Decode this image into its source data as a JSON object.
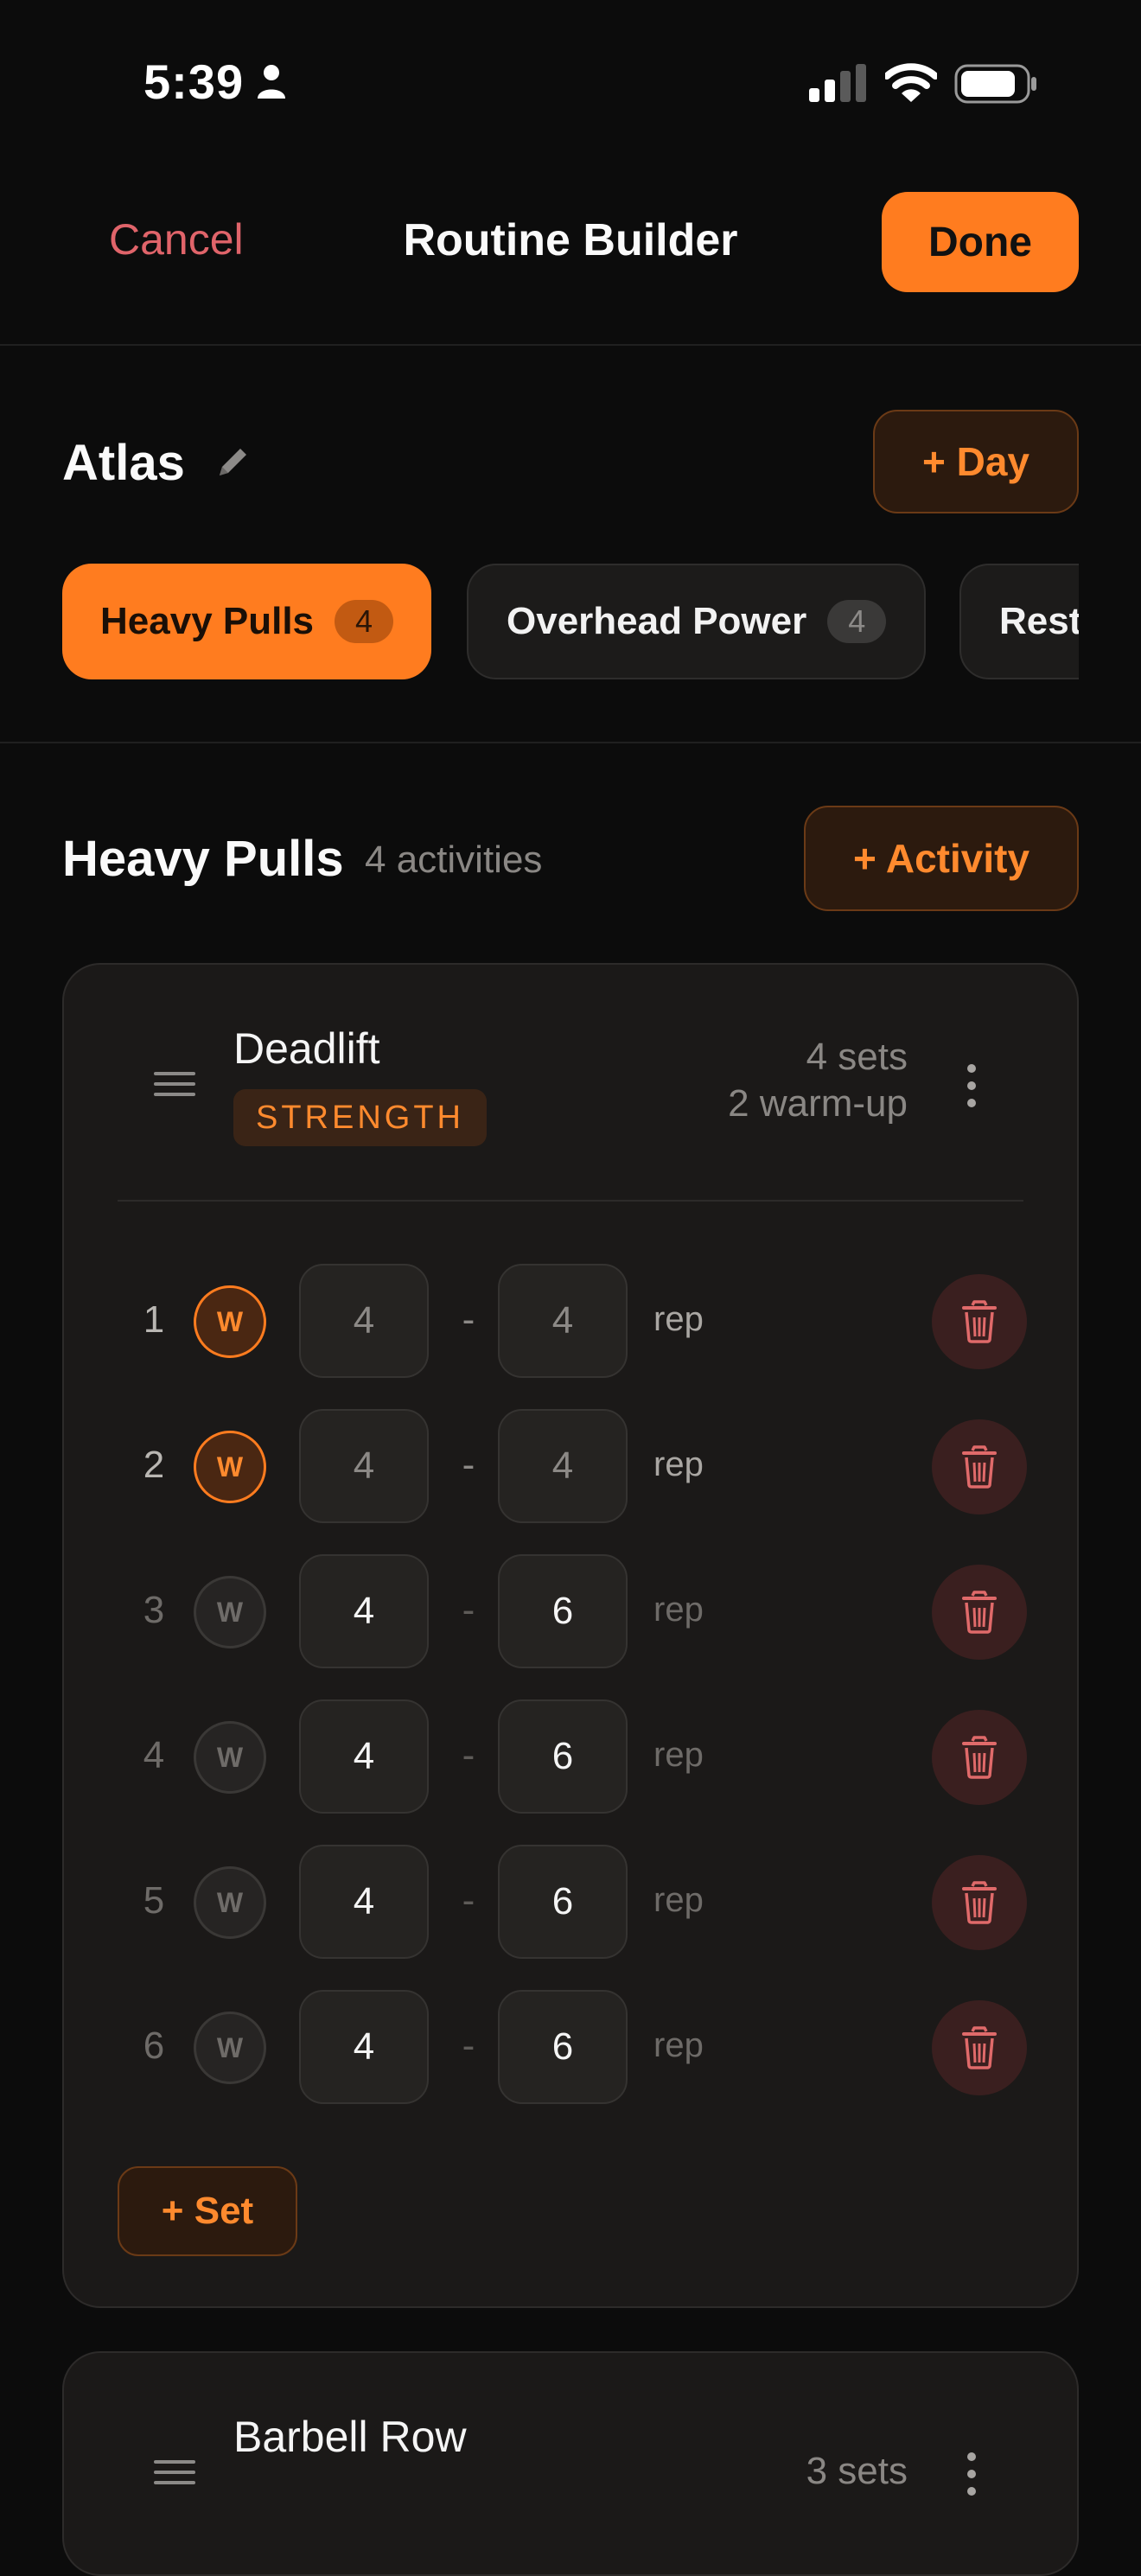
{
  "status_bar": {
    "time": "5:39"
  },
  "nav": {
    "cancel": "Cancel",
    "title": "Routine Builder",
    "done": "Done"
  },
  "routine": {
    "name": "Atlas",
    "add_day": "+ Day"
  },
  "day_tabs": [
    {
      "label": "Heavy Pulls",
      "count": "4",
      "active": true
    },
    {
      "label": "Overhead Power",
      "count": "4",
      "active": false
    },
    {
      "label": "Rest",
      "count": "",
      "active": false
    }
  ],
  "section": {
    "title": "Heavy Pulls",
    "count": "4 activities",
    "add_activity": "+ Activity"
  },
  "activities": [
    {
      "name": "Deadlift",
      "tag": "STRENGTH",
      "sets_summary": "4 sets",
      "warmup_summary": "2 warm-up",
      "sets": [
        {
          "num": "1",
          "badge": "W",
          "warmup": true,
          "min": "4",
          "max": "4",
          "unit": "rep"
        },
        {
          "num": "2",
          "badge": "W",
          "warmup": true,
          "min": "4",
          "max": "4",
          "unit": "rep"
        },
        {
          "num": "3",
          "badge": "W",
          "warmup": false,
          "min": "4",
          "max": "6",
          "unit": "rep"
        },
        {
          "num": "4",
          "badge": "W",
          "warmup": false,
          "min": "4",
          "max": "6",
          "unit": "rep"
        },
        {
          "num": "5",
          "badge": "W",
          "warmup": false,
          "min": "4",
          "max": "6",
          "unit": "rep"
        },
        {
          "num": "6",
          "badge": "W",
          "warmup": false,
          "min": "4",
          "max": "6",
          "unit": "rep"
        }
      ],
      "add_set": "+ Set"
    },
    {
      "name": "Barbell Row",
      "sets_summary": "3 sets"
    }
  ],
  "colors": {
    "accent": "#ff7c1f",
    "cancel": "#e0646a",
    "background": "#0c0c0c",
    "card": "#1b1918",
    "delete": "#e06a6a"
  },
  "icons": [
    "person-icon",
    "signal-icon",
    "wifi-icon",
    "battery-icon",
    "pencil-icon",
    "drag-handle-icon",
    "more-vertical-icon",
    "trash-icon"
  ]
}
